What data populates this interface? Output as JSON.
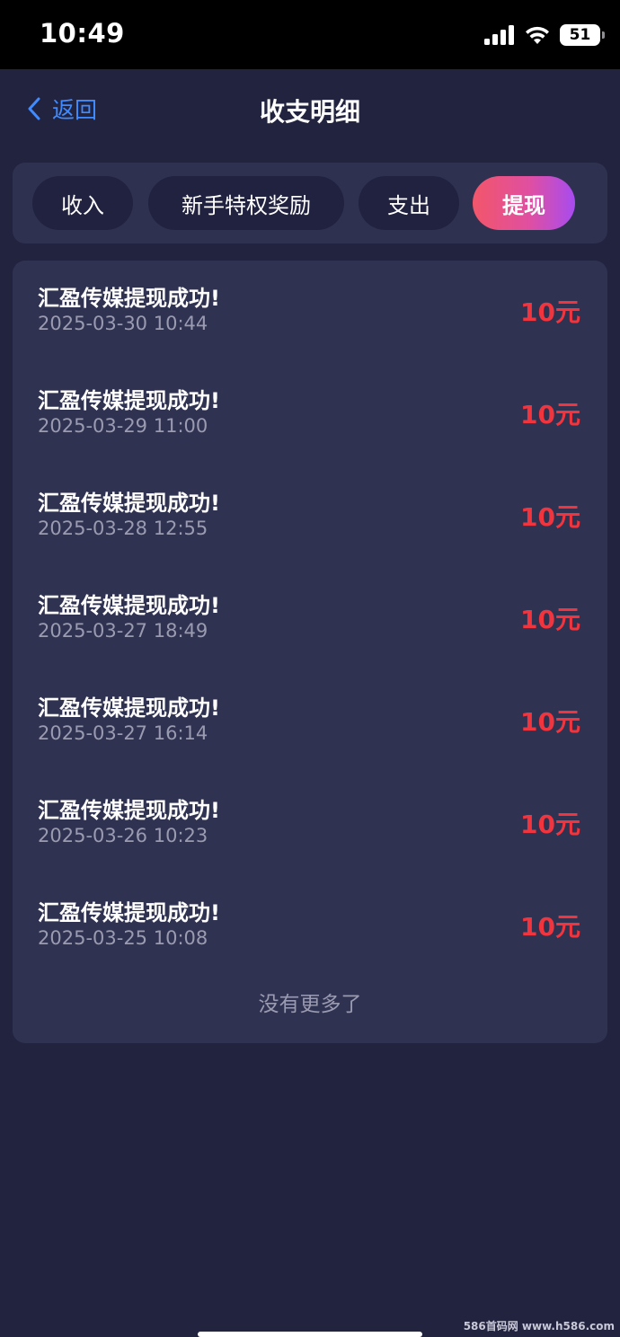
{
  "status_bar": {
    "time": "10:49",
    "battery": "51"
  },
  "nav": {
    "back_label": "返回",
    "title": "收支明细"
  },
  "tabs": [
    {
      "label": "收入",
      "active": false
    },
    {
      "label": "新手特权奖励",
      "active": false
    },
    {
      "label": "支出",
      "active": false
    },
    {
      "label": "提现",
      "active": true
    }
  ],
  "records": [
    {
      "title": "汇盈传媒提现成功!",
      "date": "2025-03-30 10:44",
      "amount": "10元"
    },
    {
      "title": "汇盈传媒提现成功!",
      "date": "2025-03-29 11:00",
      "amount": "10元"
    },
    {
      "title": "汇盈传媒提现成功!",
      "date": "2025-03-28 12:55",
      "amount": "10元"
    },
    {
      "title": "汇盈传媒提现成功!",
      "date": "2025-03-27 18:49",
      "amount": "10元"
    },
    {
      "title": "汇盈传媒提现成功!",
      "date": "2025-03-27 16:14",
      "amount": "10元"
    },
    {
      "title": "汇盈传媒提现成功!",
      "date": "2025-03-26 10:23",
      "amount": "10元"
    },
    {
      "title": "汇盈传媒提现成功!",
      "date": "2025-03-25 10:08",
      "amount": "10元"
    }
  ],
  "list_footer": "没有更多了",
  "watermark": "586首码网 www.h586.com",
  "colors": {
    "accent": "#3f8bff",
    "amount": "#f0353f",
    "background": "#22233f",
    "card": "#303252"
  }
}
